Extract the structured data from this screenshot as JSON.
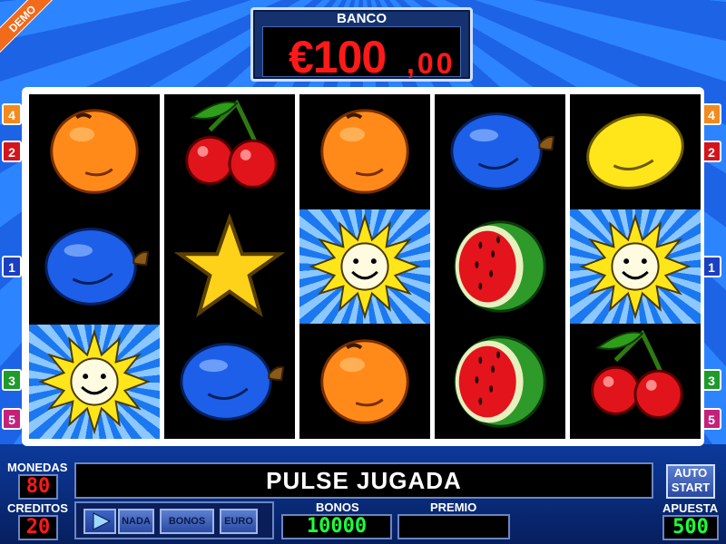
{
  "demo_label": "DEMO",
  "banco": {
    "label": "BANCO",
    "amount": "€100",
    "cents": ",00"
  },
  "lines_left": [
    "4",
    "2",
    "1",
    "3",
    "5"
  ],
  "lines_right": [
    "4",
    "2",
    "1",
    "3",
    "5"
  ],
  "reels": [
    [
      "orange",
      "plum",
      "sun"
    ],
    [
      "cherries",
      "star",
      "plum"
    ],
    [
      "orange",
      "sun",
      "orange"
    ],
    [
      "plum",
      "watermelon",
      "watermelon"
    ],
    [
      "lemon",
      "sun",
      "cherries"
    ]
  ],
  "monedas": {
    "label": "MONEDAS",
    "value": "80"
  },
  "creditos": {
    "label": "CREDITOS",
    "value": "20"
  },
  "message": "PULSE JUGADA",
  "buttons": {
    "nada": "NADA",
    "bonos": "BONOS",
    "euro": "EURO",
    "play_number": "1"
  },
  "bonos": {
    "label": "BONOS",
    "value": "10000"
  },
  "premio": {
    "label": "PREMIO",
    "value": ""
  },
  "autostart": {
    "line1": "AUTO",
    "line2": "START"
  },
  "apuesta": {
    "label": "APUESTA",
    "value": "500"
  },
  "colors": {
    "banco_digits": "#ff1a1a",
    "counter_green": "#1fff3a"
  }
}
